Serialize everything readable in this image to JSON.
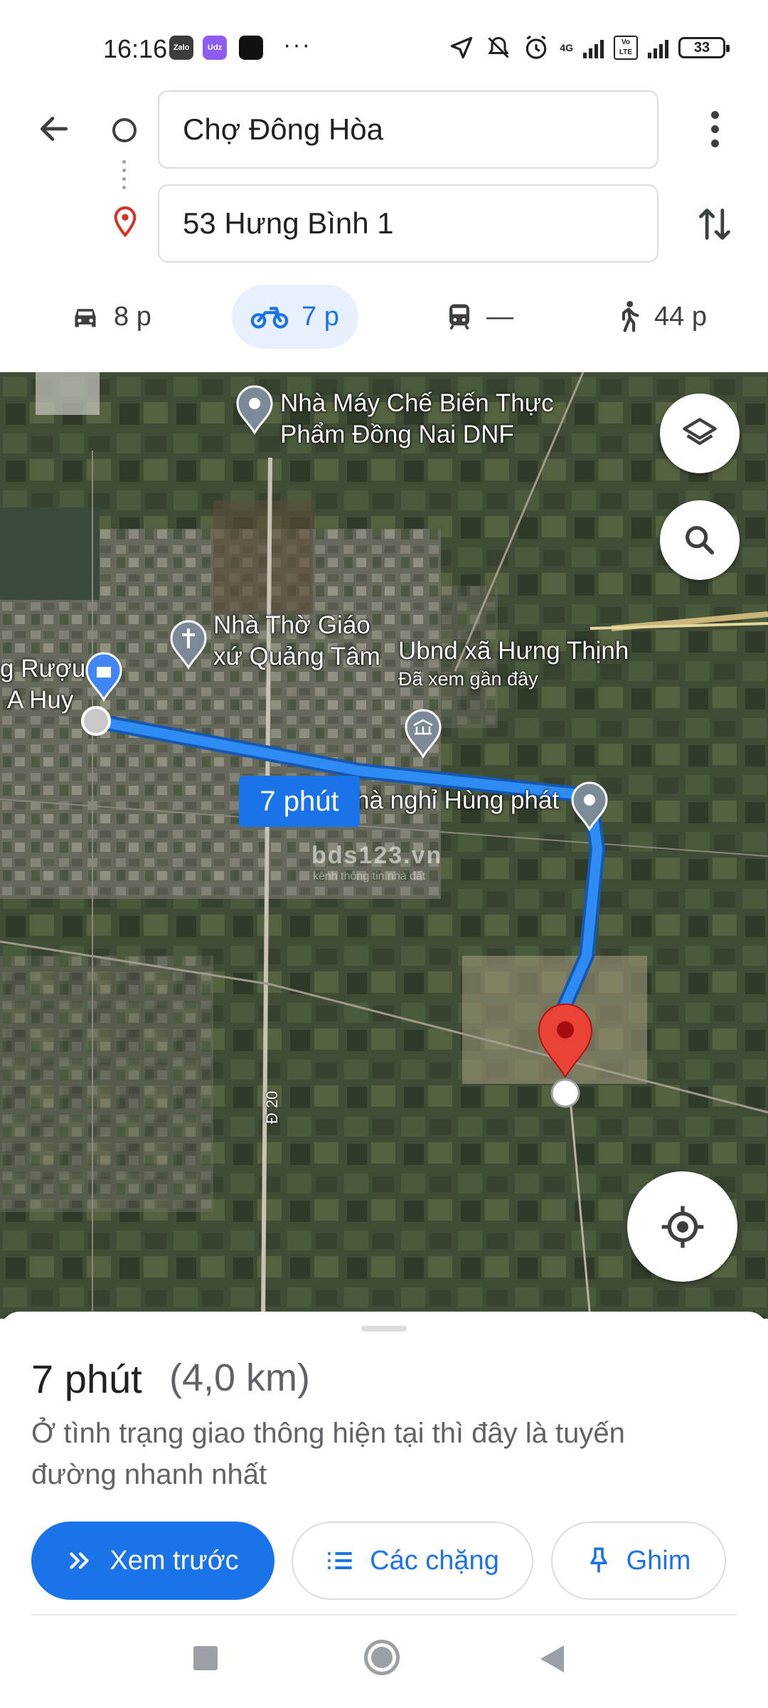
{
  "status_bar": {
    "time": "16:16",
    "apps": [
      "Zalo",
      "Udz"
    ],
    "more": "···",
    "network_4g": "4G",
    "volte": "Vo LTE",
    "battery": "33"
  },
  "route": {
    "origin": "Chợ Đông Hòa",
    "destination": "53 Hưng Bình 1"
  },
  "modes": [
    {
      "name": "car",
      "icon": "car-icon",
      "time": "8 p"
    },
    {
      "name": "motorbike",
      "icon": "motorbike-icon",
      "time": "7 p",
      "selected": true
    },
    {
      "name": "transit",
      "icon": "transit-icon",
      "time": "—"
    },
    {
      "name": "walk",
      "icon": "walk-icon",
      "time": "44 p"
    }
  ],
  "map": {
    "labels": {
      "factory_line1": "Nhà Máy Chế Biến Thực",
      "factory_line2": "Phẩm Đồng Nai DNF",
      "church_line1": "Nhà Thờ Giáo",
      "church_line2": "xứ Quảng Tâm",
      "ubnd": "Ubnd xã Hưng Thịnh",
      "ubnd_sub": "Đã xem gần đây",
      "shop_line1": "g Rượu",
      "shop_line2": "A Huy",
      "motel": "hà nghỉ Hùng phát",
      "road": "Đ 20"
    },
    "route_duration": "7 phút",
    "watermark": "bds123.vn",
    "watermark_sub": "kênh thông tin nhà đất",
    "route_color": "#1a73e8"
  },
  "sheet": {
    "duration": "7 phút",
    "distance": "(4,0 km)",
    "description": "Ở tình trạng giao thông hiện tại thì đây là tuyến đường nhanh nhất",
    "buttons": {
      "preview": "Xem trước",
      "steps": "Các chặng",
      "pin": "Ghim"
    }
  }
}
